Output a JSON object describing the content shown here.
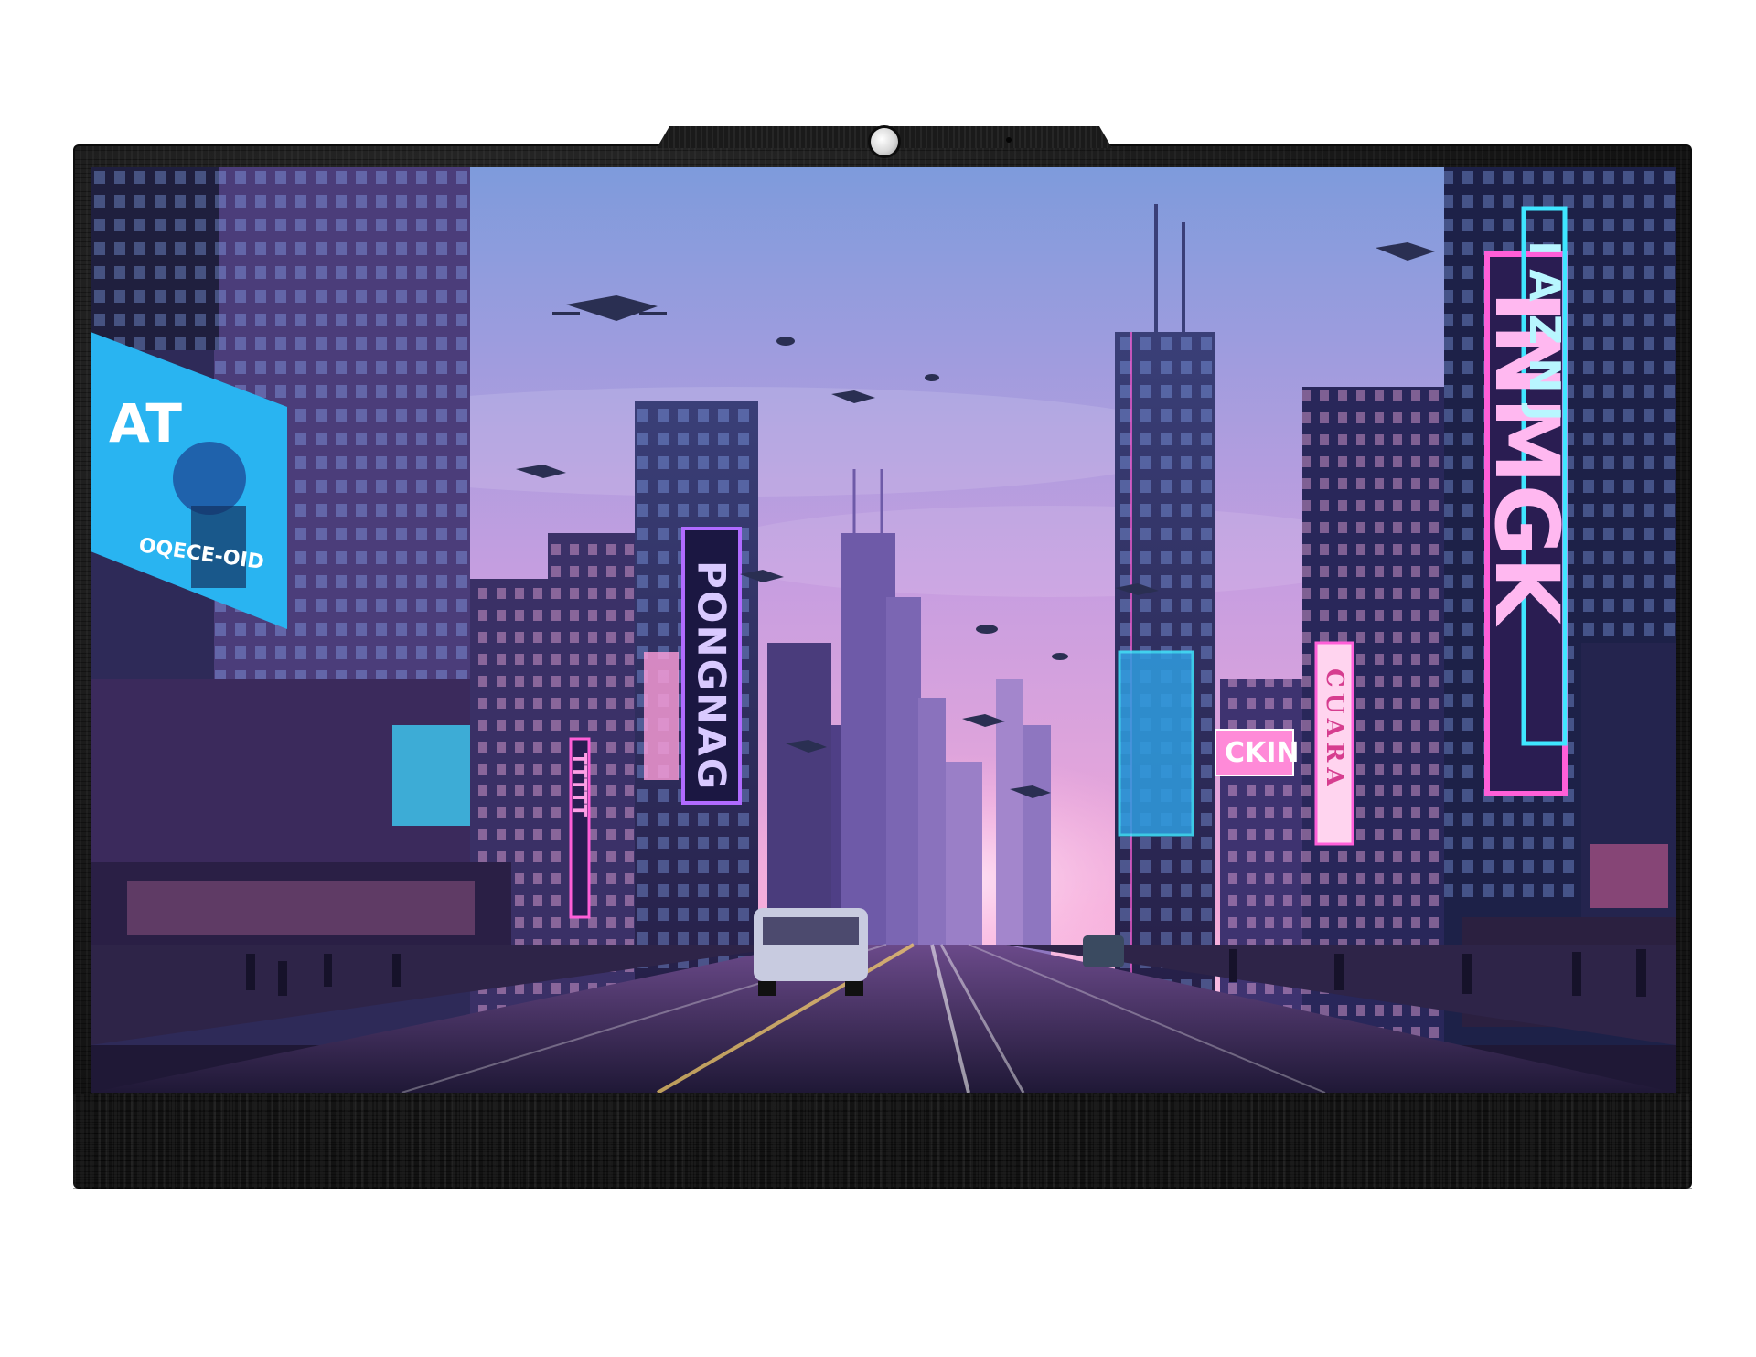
{
  "scene": {
    "sky_top": "#7e9bdc",
    "sky_mid": "#c79ee0",
    "sky_horizon": "#f3a9d8",
    "street": "#35264f",
    "neon_cyan": "#3fe6ff",
    "neon_pink": "#ff5fd8",
    "neon_purple": "#b06bff"
  },
  "signs": {
    "billboard_logo": "AT",
    "billboard_caption": "OQECE-OID",
    "tower_sign": "PONGNAG",
    "tall_pink_sign": "INMGK",
    "tall_cyan_sign": "IAZNJ",
    "cuara_sign": "CUARA",
    "small_sign": "CKIN",
    "left_vertical_sign": "TTTTT"
  }
}
